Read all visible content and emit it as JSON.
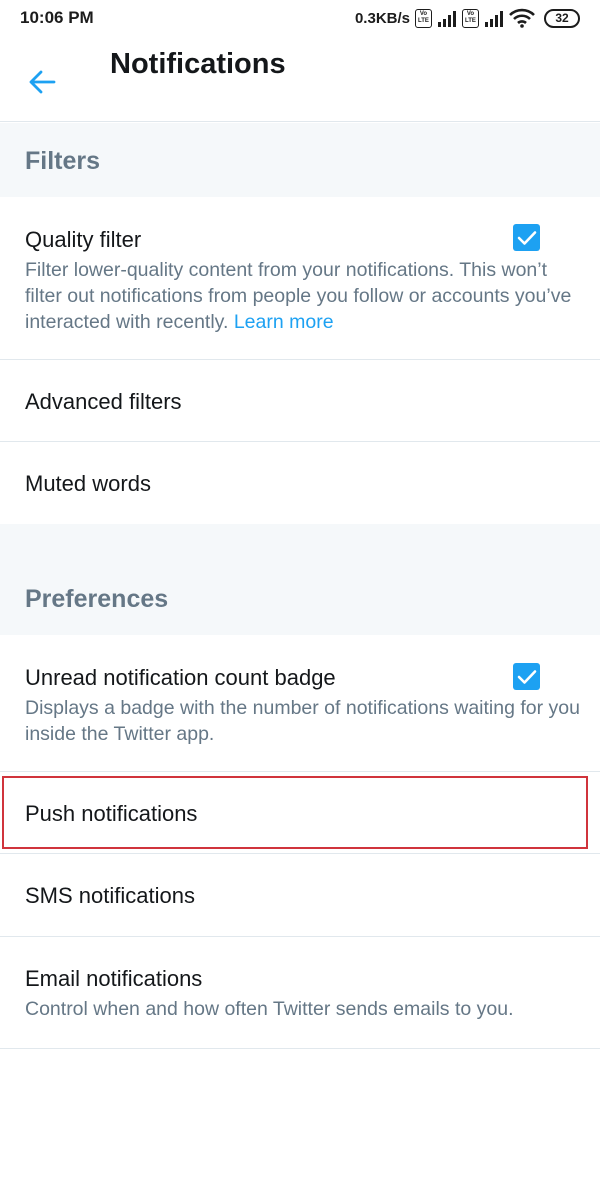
{
  "status_bar": {
    "time": "10:06 PM",
    "speed": "0.3KB/s",
    "volte_top": "Vo",
    "volte_bottom": "LTE",
    "battery": "32"
  },
  "header": {
    "title": "Notifications",
    "back_icon": "arrow-left-icon"
  },
  "filters": {
    "title": "Filters",
    "quality_filter": {
      "label": "Quality filter",
      "description": "Filter lower-quality content from your notifications. This won’t filter out notifications from people you follow or accounts you’ve interacted with recently.",
      "link": "Learn more",
      "checked": true
    },
    "advanced_filters": {
      "label": "Advanced filters"
    },
    "muted_words": {
      "label": "Muted words"
    }
  },
  "preferences": {
    "title": "Preferences",
    "unread_badge": {
      "label": "Unread notification count badge",
      "description": "Displays a badge with the number of notifications waiting for you inside the Twitter app.",
      "checked": true
    },
    "push_notifications": {
      "label": "Push notifications"
    },
    "sms_notifications": {
      "label": "SMS notifications"
    },
    "email_notifications": {
      "label": "Email notifications",
      "description": "Control when and how often Twitter sends emails to you."
    }
  },
  "colors": {
    "accent": "#1da1f2",
    "highlight": "#d0343c",
    "section_bg": "#f5f8fa",
    "secondary_text": "#657786"
  }
}
